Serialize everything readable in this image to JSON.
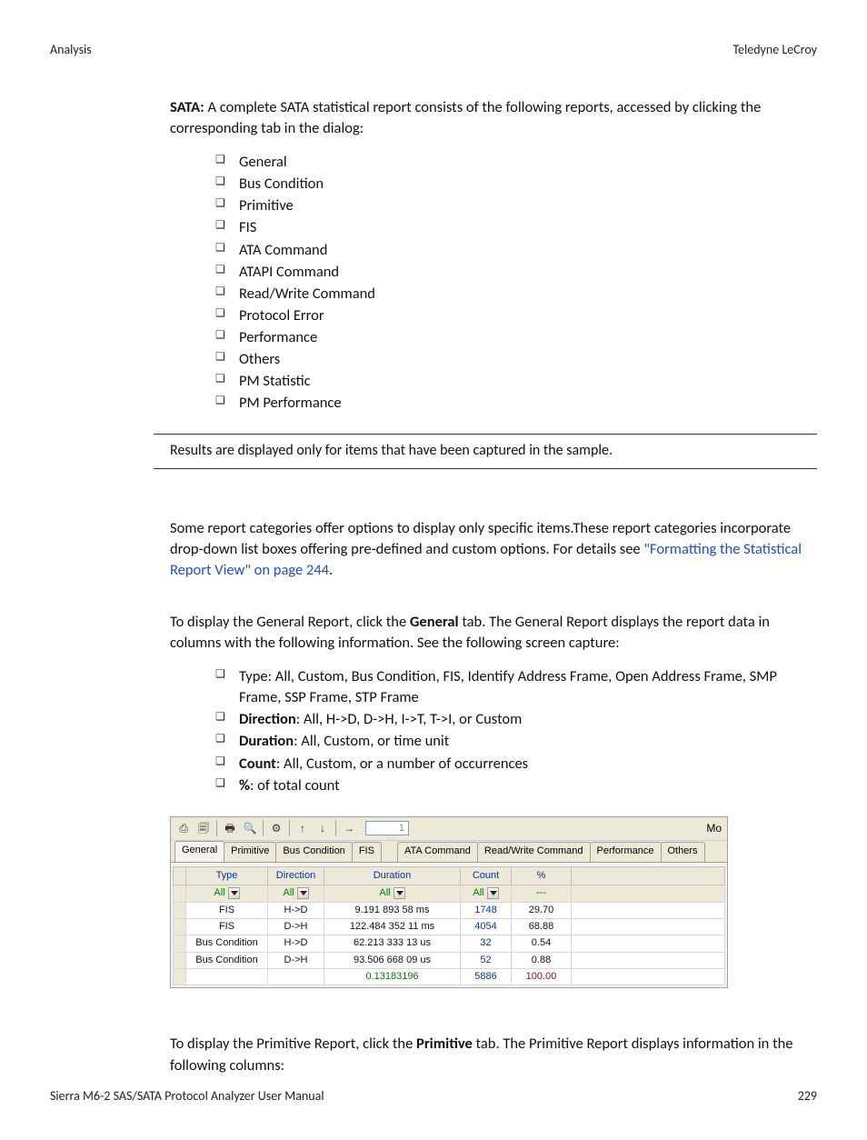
{
  "header": {
    "left": "Analysis",
    "right": "Teledyne LeCroy"
  },
  "footer": {
    "left": "Sierra M6-2 SAS/SATA Protocol Analyzer User Manual",
    "right": "229"
  },
  "intro": {
    "prefix": "SATA:",
    "text": " A complete SATA statistical report consists of the following reports, accessed by clicking the corresponding tab in the dialog:"
  },
  "reports": [
    "General",
    "Bus Condition",
    "Primitive",
    "FIS",
    "ATA Command",
    "ATAPI Command",
    "Read/Write Command",
    "Protocol Error",
    "Performance",
    "Others",
    "PM Statistic",
    "PM Performance"
  ],
  "note": "Results are displayed only for items that have been captured in the sample.",
  "body1": {
    "pre": "Some report categories offer options to display only specific items.These report categories incorporate drop-down list boxes offering pre-defined and custom options. For details see ",
    "link": "\"Formatting the Statistical Report View\" on page 244",
    "post": "."
  },
  "body2": {
    "pre": "To display the General Report, click the ",
    "b": "General",
    "post": " tab. The General Report displays the report data in columns with the following information. See the following screen capture:"
  },
  "gen_items": [
    {
      "b": "",
      "text": "Type: All, Custom, Bus Condition, FIS, Identify Address Frame, Open Address Frame, SMP Frame, SSP Frame, STP Frame"
    },
    {
      "b": "Direction",
      "text": ": All, H->D, D->H, I->T, T->I, or Custom"
    },
    {
      "b": "Duration",
      "text": ": All, Custom, or time unit"
    },
    {
      "b": "Count",
      "text": ": All, Custom, or a number of occurrences"
    },
    {
      "b": "%",
      "text": ": of total count"
    }
  ],
  "body3": {
    "pre": "To display the Primitive Report, click the ",
    "b": "Primitive",
    "post": " tab. The Primitive Report displays information in the following columns:"
  },
  "screenshot": {
    "page_value": "1",
    "mo": "Mo",
    "tabs": [
      "General",
      "Primitive",
      "Bus Condition",
      "FIS",
      "ATA Command",
      "Read/Write Command",
      "Performance",
      "Others"
    ],
    "active_tab": 0,
    "columns": [
      "Type",
      "Direction",
      "Duration",
      "Count",
      "%"
    ],
    "filters": {
      "type": "All",
      "direction": "All",
      "duration": "All",
      "count": "All",
      "percent": "---"
    },
    "rows": [
      {
        "type": "FIS",
        "dir": "H->D",
        "dur": "9.191 893 58  ms",
        "count": "1748",
        "pct": "29.70"
      },
      {
        "type": "FIS",
        "dir": "D->H",
        "dur": "122.484 352 11  ms",
        "count": "4054",
        "pct": "68.88"
      },
      {
        "type": "Bus Condition",
        "dir": "H->D",
        "dur": "62.213 333 13  us",
        "count": "32",
        "pct": "0.54"
      },
      {
        "type": "Bus Condition",
        "dir": "D->H",
        "dur": "93.506 668 09  us",
        "count": "52",
        "pct": "0.88"
      }
    ],
    "totals": {
      "dur": "0.13183196",
      "count": "5886",
      "pct": "100.00"
    }
  },
  "icons": {
    "i1": "⎙",
    "i2": "🗐",
    "i3": "🖶",
    "i4": "🔍",
    "i5": "⚙",
    "i6": "↑",
    "i7": "↓",
    "i8": "→"
  }
}
